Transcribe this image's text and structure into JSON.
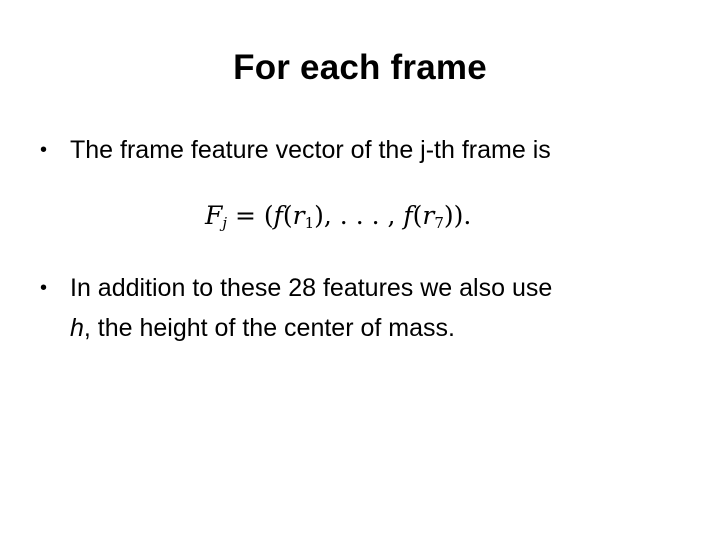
{
  "slide": {
    "title": "For each frame",
    "bullets": [
      {
        "marker": "•",
        "text": "The frame feature vector of the j-th frame is"
      },
      {
        "marker": "•",
        "text_line1": "In addition to these 28 features we also use",
        "var": "h",
        "text_line2": ", the height of the center of mass."
      }
    ],
    "formula": {
      "lhs_var": "F",
      "lhs_sub": "j",
      "equals": " = ",
      "open": "(",
      "f1": "f",
      "arg1_var": "r",
      "arg1_sub": "1",
      "sep": "), . . . , ",
      "f2": "f",
      "arg2_var": "r",
      "arg2_sub": "7",
      "close": ")).",
      "paren_open": "("
    }
  }
}
